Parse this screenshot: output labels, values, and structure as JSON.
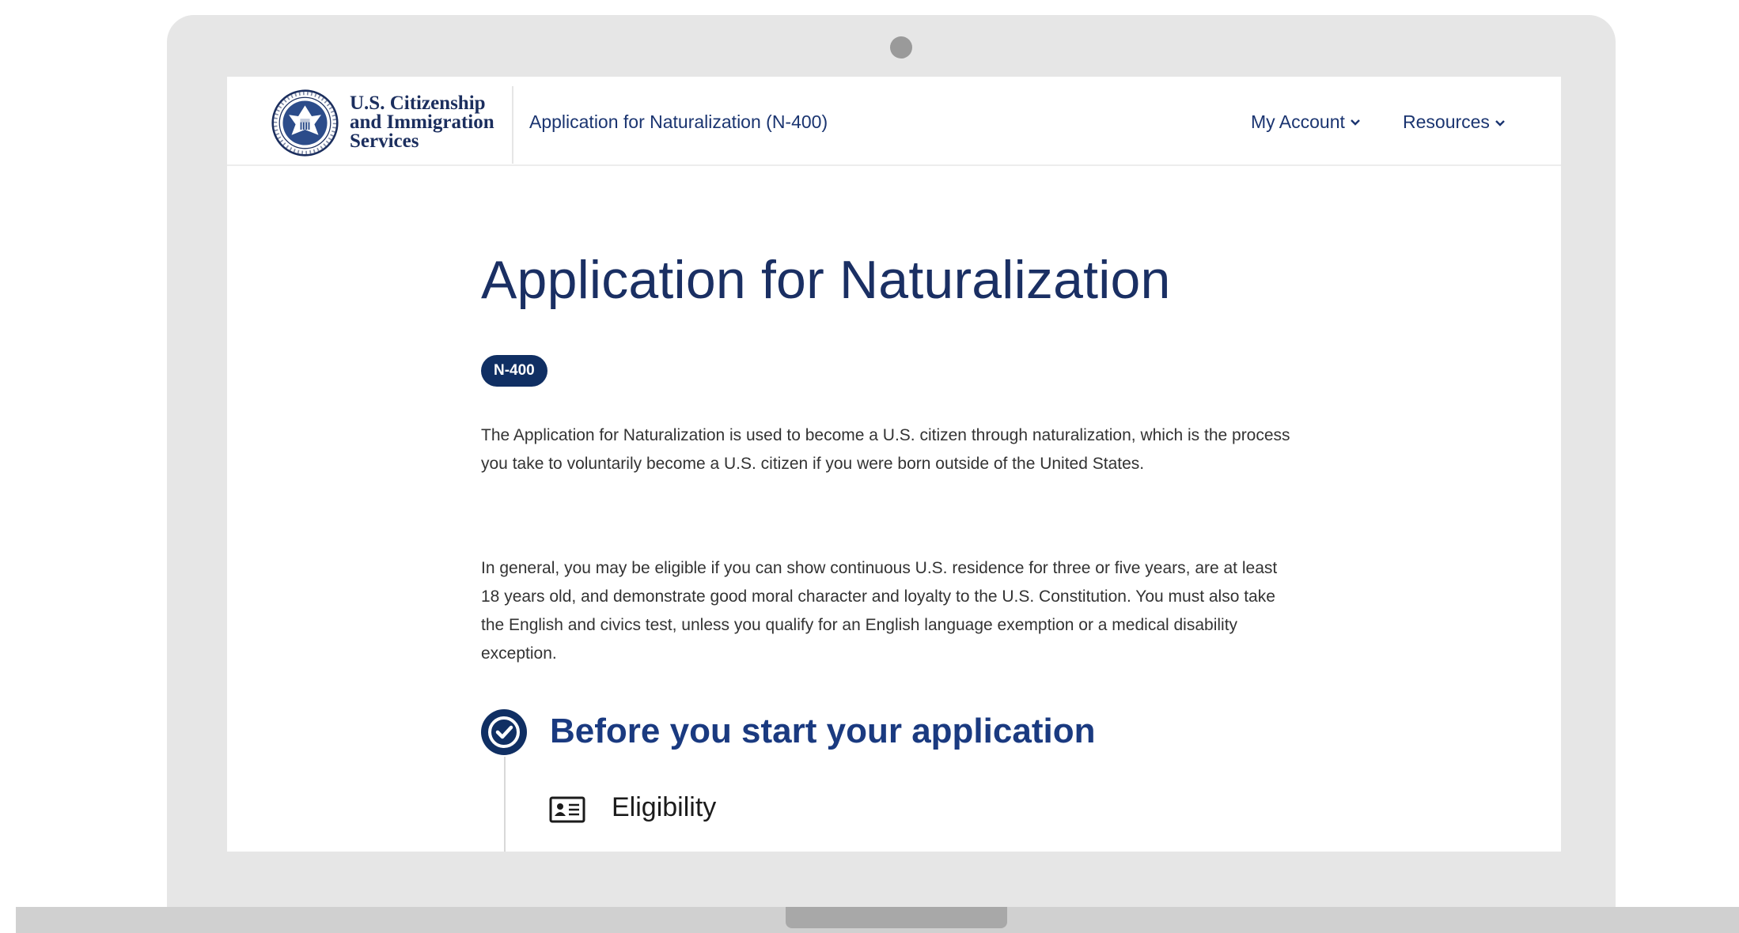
{
  "header": {
    "agency_name_lines": [
      "U.S. Citizenship",
      "and Immigration",
      "Services"
    ],
    "app_title": "Application for Naturalization (N-400)",
    "nav": [
      {
        "label": "My Account",
        "icon": "chevron-down-icon"
      },
      {
        "label": "Resources",
        "icon": "chevron-down-icon"
      }
    ]
  },
  "main": {
    "title": "Application for Naturalization",
    "form_badge": "N-400",
    "intro_paragraphs": [
      "The Application for Naturalization is used to become a U.S. citizen through naturalization, which is the process you take to voluntarily become a U.S. citizen if you were born outside of the United States.",
      "In general, you may be eligible if you can show continuous U.S. residence for three or five years, are at least 18 years old, and demonstrate good moral character and loyalty to the U.S. Constitution. You must also take the English and civics test, unless you qualify for an English language exemption or a medical disability exception."
    ],
    "section": {
      "title": "Before you start your application",
      "icon": "check-circle-icon",
      "items": [
        {
          "label": "Eligibility",
          "icon": "id-card-icon"
        }
      ]
    }
  },
  "colors": {
    "brand_navy": "#102f63",
    "link_blue": "#1a3470",
    "laptop_frame": "#e6e6e6"
  }
}
